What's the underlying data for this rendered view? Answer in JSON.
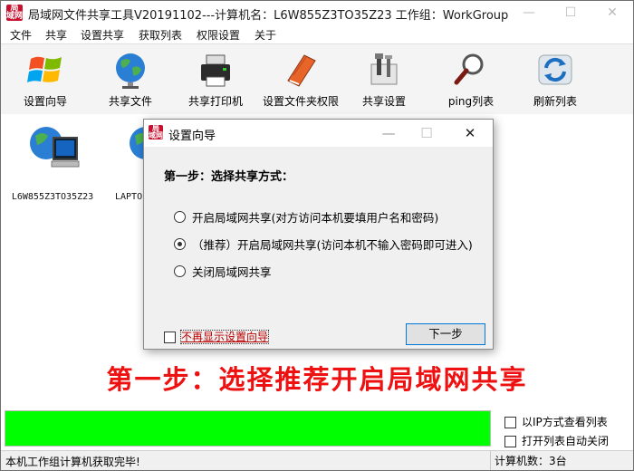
{
  "window": {
    "title": "局域网文件共享工具V20191102---计算机名：L6W855Z3TO35Z23  工作组：WorkGroup",
    "logo_text": [
      "局",
      "域网"
    ]
  },
  "menu": [
    "文件",
    "共享",
    "设置共享",
    "获取列表",
    "权限设置",
    "关于"
  ],
  "toolbar": [
    {
      "label": "设置向导",
      "icon": "windows-logo-icon"
    },
    {
      "label": "共享文件",
      "icon": "globe-icon"
    },
    {
      "label": "共享打印机",
      "icon": "printer-icon"
    },
    {
      "label": "设置文件夹权限",
      "icon": "book-icon"
    },
    {
      "label": "共享设置",
      "icon": "tools-icon"
    },
    {
      "label": "ping列表",
      "icon": "magnifier-icon"
    },
    {
      "label": "刷新列表",
      "icon": "refresh-icon"
    }
  ],
  "computers": [
    {
      "name": "L6W855Z3TO35Z23"
    },
    {
      "name": "LAPTO"
    }
  ],
  "banner": "第一步：选择推荐开启局域网共享",
  "progress": {
    "value": 1.0,
    "color": "#00ff00"
  },
  "options": [
    {
      "label": "以IP方式查看列表",
      "checked": false
    },
    {
      "label": "打开列表自动关闭",
      "checked": false
    }
  ],
  "status": {
    "message": "本机工作组计算机获取完毕!",
    "count": "计算机数：3台"
  },
  "dialog": {
    "title": "设置向导",
    "step": "第一步：选择共享方式：",
    "radios": [
      {
        "label": "开启局域网共享(对方访问本机要填用户名和密码)",
        "checked": false
      },
      {
        "label": "（推荐）开启局域网共享(访问本机不输入密码即可进入)",
        "checked": true
      },
      {
        "label": "关闭局域网共享",
        "checked": false
      }
    ],
    "dont_show": "不再显示设置向导",
    "next": "下一步"
  },
  "colors": {
    "banner": "#ee1111",
    "progress": "#00ff00",
    "accent": "#0078d7"
  }
}
